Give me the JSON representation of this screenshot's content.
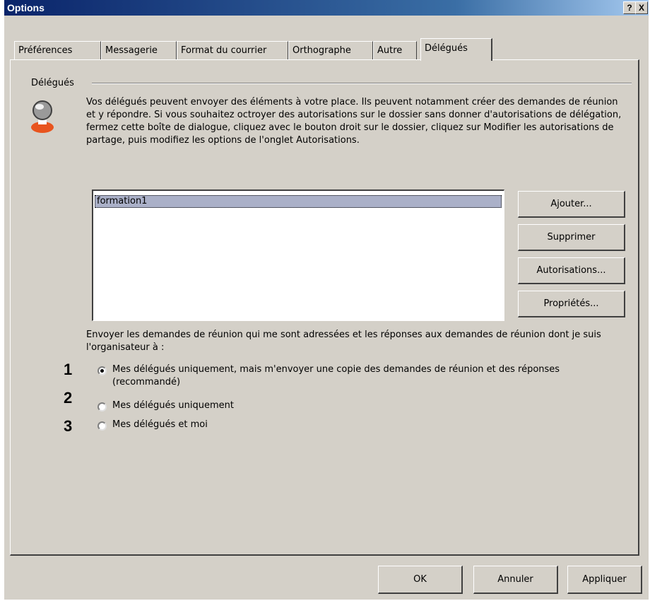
{
  "window": {
    "title": "Options",
    "help_btn": "?",
    "close_btn": "X"
  },
  "tabs": [
    {
      "label": "Préférences"
    },
    {
      "label": "Messagerie"
    },
    {
      "label": "Format du courrier"
    },
    {
      "label": "Orthographe"
    },
    {
      "label": "Autre"
    },
    {
      "label": "Délégués"
    }
  ],
  "active_tab": "Délégués",
  "group": {
    "label": "Délégués",
    "description": "Vos délégués peuvent envoyer des éléments à votre place. Ils peuvent notamment créer des demandes de réunion et y répondre. Si vous souhaitez octroyer des autorisations sur le dossier sans donner d'autorisations de délégation, fermez cette boîte de dialogue, cliquez avec le bouton droit sur le dossier, cliquez sur Modifier les autorisations de partage, puis modifiez les options de l'onglet Autorisations."
  },
  "delegates": {
    "items": [
      "formation1"
    ],
    "selected": "formation1"
  },
  "side_buttons": {
    "add": "Ajouter...",
    "remove": "Supprimer",
    "permissions": "Autorisations...",
    "properties": "Propriétés..."
  },
  "meeting": {
    "prompt": "Envoyer les demandes de réunion qui me sont adressées et les réponses aux demandes de réunion dont je suis l'organisateur à :",
    "options": [
      {
        "number": "1",
        "label": "Mes délégués uniquement, mais m'envoyer une copie des demandes de réunion et des réponses (recommandé)",
        "checked": true
      },
      {
        "number": "2",
        "label": "Mes délégués uniquement",
        "checked": false
      },
      {
        "number": "3",
        "label": "Mes délégués et moi",
        "checked": false
      }
    ]
  },
  "footer": {
    "ok": "OK",
    "cancel": "Annuler",
    "apply": "Appliquer"
  },
  "colors": {
    "titlebar": "#0a246a",
    "dialog_bg": "#d4d0c8",
    "selection": "#aab0c8",
    "icon_accent": "#e8541e"
  },
  "icons": [
    "delegate-user-icon",
    "help-icon",
    "close-icon"
  ]
}
